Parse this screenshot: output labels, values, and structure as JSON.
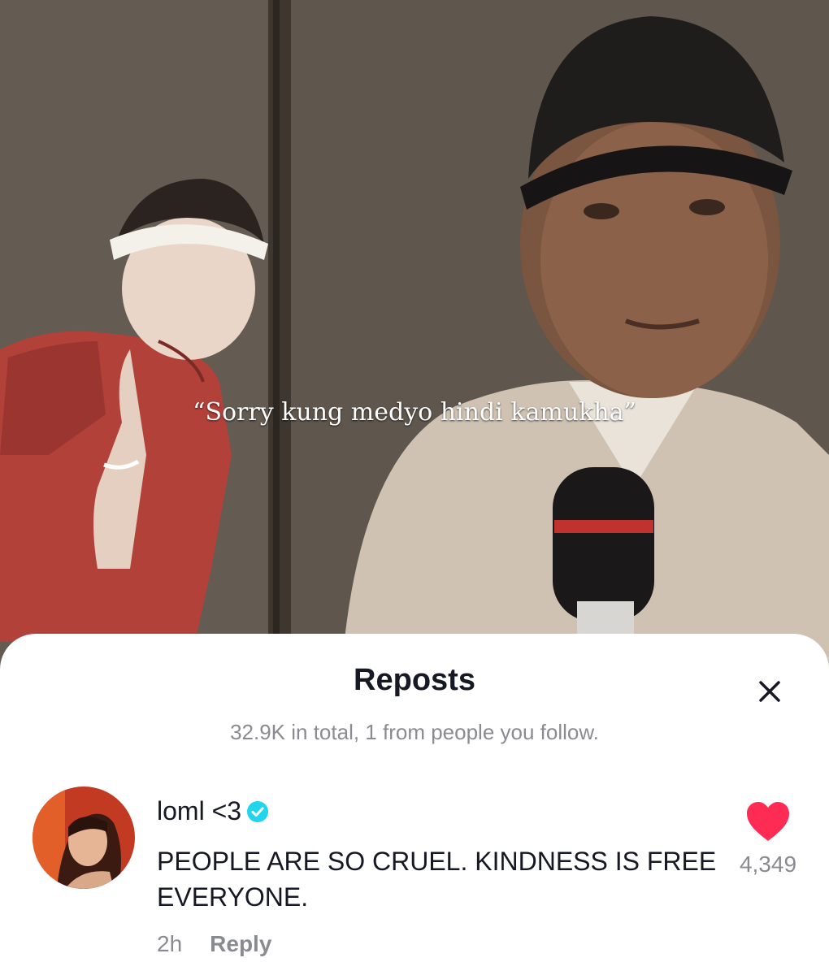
{
  "video": {
    "caption": "“Sorry kung medyo hindi kamukha”"
  },
  "sheet": {
    "title": "Reposts",
    "subtitle": "32.9K in total, 1 from people you follow."
  },
  "comment": {
    "username": "loml <3",
    "text": "PEOPLE ARE SO CRUEL. KINDNESS IS FREE EVERYONE.",
    "time": "2h",
    "reply_label": "Reply",
    "like_count": "4,349",
    "verified": true
  },
  "icons": {
    "close": "close-icon",
    "like": "heart-icon",
    "verified": "verified-badge-icon"
  },
  "colors": {
    "like_red": "#fe2c55",
    "verified_blue": "#20d5ec",
    "text_primary": "#161823",
    "text_secondary": "#8a8b91"
  }
}
